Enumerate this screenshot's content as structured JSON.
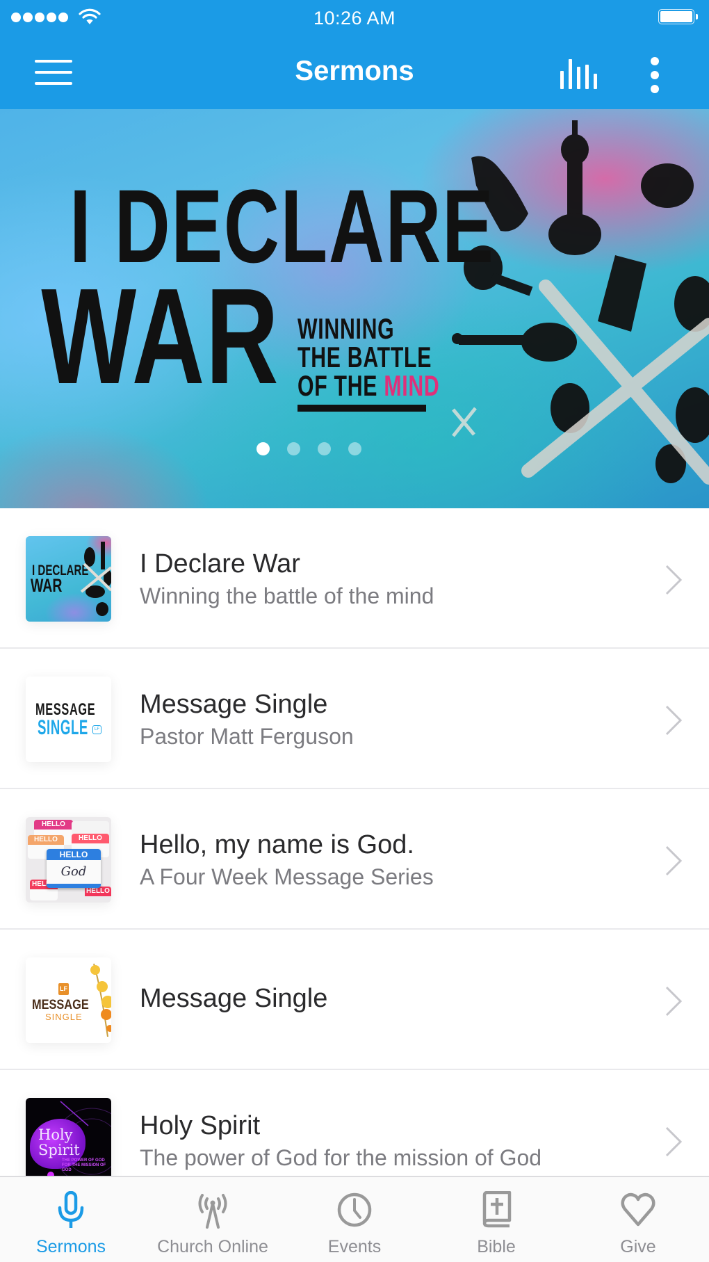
{
  "status_bar": {
    "time": "10:26 AM",
    "signal_bars": 5,
    "wifi_icon": "wifi-icon",
    "battery_level": 1.0
  },
  "nav_bar": {
    "title": "Sermons",
    "menu_icon": "hamburger-menu-icon",
    "audio_icon": "audio-levels-icon",
    "more_icon": "more-vertical-icon",
    "bg_color": "#1b9be6"
  },
  "banner": {
    "headline_line1": "I DECLARE",
    "headline_line2": "WAR",
    "tagline_line1": "WINNING",
    "tagline_line2": "THE BATTLE",
    "tagline_line3_prefix": "OF THE ",
    "tagline_line3_highlight": "MIND",
    "highlight_color": "#e0307a",
    "page_count": 4,
    "active_page": 1
  },
  "sermons": [
    {
      "title": "I Declare War",
      "subtitle": "Winning the battle of the mind",
      "thumb": {
        "line1": "I DECLARE",
        "line2": "WAR"
      }
    },
    {
      "title": "Message Single",
      "subtitle": "Pastor Matt Ferguson",
      "thumb": {
        "line1": "MESSAGE",
        "line2": "SINGLE",
        "badge": "LF"
      }
    },
    {
      "title": "Hello, my name is God.",
      "subtitle": "A Four Week Message Series",
      "thumb": {
        "tag_header": "HELLO",
        "tag_name": "God"
      }
    },
    {
      "title": "Message Single",
      "subtitle": "",
      "thumb": {
        "badge": "LF",
        "line1": "MESSAGE",
        "line2": "SINGLE"
      }
    },
    {
      "title": "Holy Spirit",
      "subtitle": "The power of God for the mission of God",
      "thumb": {
        "line1": "Holy",
        "line2": "Spirit",
        "sub1": "THE POWER OF GOD",
        "sub2": "FOR THE MISSION OF GOD"
      }
    }
  ],
  "tab_bar": {
    "active_color": "#1b9be6",
    "inactive_color": "#8e8e93",
    "tabs": [
      {
        "label": "Sermons",
        "icon": "microphone-icon",
        "active": true
      },
      {
        "label": "Church Online",
        "icon": "broadcast-tower-icon",
        "active": false
      },
      {
        "label": "Events",
        "icon": "clock-icon",
        "active": false
      },
      {
        "label": "Bible",
        "icon": "bible-icon",
        "active": false
      },
      {
        "label": "Give",
        "icon": "heart-icon",
        "active": false
      }
    ]
  }
}
